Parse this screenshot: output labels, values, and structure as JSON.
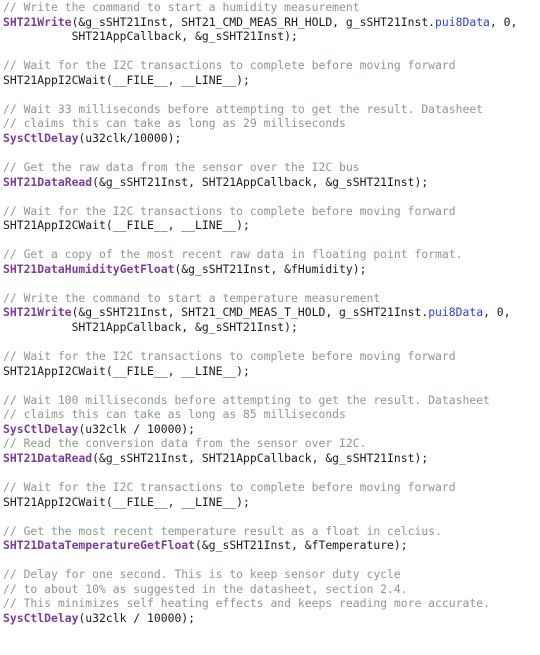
{
  "editor": {
    "language": "C",
    "background_color": "#ffffff",
    "comment_color": "#8a9a8a",
    "function_color": "#7d3c98",
    "member_color": "#2e3fd4",
    "number_color": "#1a1aa8",
    "plain_color": "#1b1b1b"
  },
  "lines": [
    {
      "n": 1,
      "type": "comment",
      "text": "// Write the command to start a humidity measurement"
    },
    {
      "n": 2,
      "type": "code",
      "func": "SHT21Write",
      "after": "(&g_sSHT21Inst, SHT21_CMD_MEAS_RH_HOLD, g_sSHT21Inst.",
      "member": "pui8Data",
      "tail": ", 0,"
    },
    {
      "n": 3,
      "type": "code",
      "text": "          SHT21AppCallback, &g_sSHT21Inst);"
    },
    {
      "n": 4,
      "type": "blank",
      "text": ""
    },
    {
      "n": 5,
      "type": "comment",
      "text": "// Wait for the I2C transactions to complete before moving forward"
    },
    {
      "n": 6,
      "type": "code",
      "text": "SHT21AppI2CWait(__FILE__, __LINE__);"
    },
    {
      "n": 7,
      "type": "blank",
      "text": ""
    },
    {
      "n": 8,
      "type": "comment",
      "text": "// Wait 33 milliseconds before attempting to get the result. Datasheet"
    },
    {
      "n": 9,
      "type": "comment",
      "text": "// claims this can take as long as 29 milliseconds"
    },
    {
      "n": 10,
      "type": "code",
      "func": "SysCtlDelay",
      "after": "(u32clk/10000);"
    },
    {
      "n": 11,
      "type": "blank",
      "text": ""
    },
    {
      "n": 12,
      "type": "comment",
      "text": "// Get the raw data from the sensor over the I2C bus"
    },
    {
      "n": 13,
      "type": "code",
      "func": "SHT21DataRead",
      "after": "(&g_sSHT21Inst, SHT21AppCallback, &g_sSHT21Inst);"
    },
    {
      "n": 14,
      "type": "blank",
      "text": ""
    },
    {
      "n": 15,
      "type": "comment",
      "text": "// Wait for the I2C transactions to complete before moving forward"
    },
    {
      "n": 16,
      "type": "code",
      "text": "SHT21AppI2CWait(__FILE__, __LINE__);"
    },
    {
      "n": 17,
      "type": "blank",
      "text": ""
    },
    {
      "n": 18,
      "type": "comment",
      "text": "// Get a copy of the most recent raw data in floating point format."
    },
    {
      "n": 19,
      "type": "code",
      "func": "SHT21DataHumidityGetFloat",
      "after": "(&g_sSHT21Inst, &fHumidity);"
    },
    {
      "n": 20,
      "type": "blank",
      "text": ""
    },
    {
      "n": 21,
      "type": "comment",
      "text": "// Write the command to start a temperature measurement"
    },
    {
      "n": 22,
      "type": "code",
      "func": "SHT21Write",
      "after": "(&g_sSHT21Inst, SHT21_CMD_MEAS_T_HOLD, g_sSHT21Inst.",
      "member": "pui8Data",
      "tail": ", 0,"
    },
    {
      "n": 23,
      "type": "code",
      "text": "          SHT21AppCallback, &g_sSHT21Inst);"
    },
    {
      "n": 24,
      "type": "blank",
      "text": ""
    },
    {
      "n": 25,
      "type": "comment",
      "text": "// Wait for the I2C transactions to complete before moving forward"
    },
    {
      "n": 26,
      "type": "code",
      "text": "SHT21AppI2CWait(__FILE__, __LINE__);"
    },
    {
      "n": 27,
      "type": "blank",
      "text": ""
    },
    {
      "n": 28,
      "type": "comment",
      "text": "// Wait 100 milliseconds before attempting to get the result. Datasheet"
    },
    {
      "n": 29,
      "type": "comment",
      "text": "// claims this can take as long as 85 milliseconds"
    },
    {
      "n": 30,
      "type": "code",
      "func": "SysCtlDelay",
      "after": "(u32clk / 10000);"
    },
    {
      "n": 31,
      "type": "comment",
      "text": "// Read the conversion data from the sensor over I2C."
    },
    {
      "n": 32,
      "type": "code",
      "func": "SHT21DataRead",
      "after": "(&g_sSHT21Inst, SHT21AppCallback, &g_sSHT21Inst);"
    },
    {
      "n": 33,
      "type": "blank",
      "text": ""
    },
    {
      "n": 34,
      "type": "comment",
      "text": "// Wait for the I2C transactions to complete before moving forward"
    },
    {
      "n": 35,
      "type": "code",
      "text": "SHT21AppI2CWait(__FILE__, __LINE__);"
    },
    {
      "n": 36,
      "type": "blank",
      "text": ""
    },
    {
      "n": 37,
      "type": "comment",
      "text": "// Get the most recent temperature result as a float in celcius."
    },
    {
      "n": 38,
      "type": "code",
      "func": "SHT21DataTemperatureGetFloat",
      "after": "(&g_sSHT21Inst, &fTemperature);"
    },
    {
      "n": 39,
      "type": "blank",
      "text": ""
    },
    {
      "n": 40,
      "type": "comment",
      "text": "// Delay for one second. This is to keep sensor duty cycle"
    },
    {
      "n": 41,
      "type": "comment",
      "text": "// to about 10% as suggested in the datasheet, section 2.4."
    },
    {
      "n": 42,
      "type": "comment",
      "text": "// This minimizes self heating effects and keeps reading more accurate."
    },
    {
      "n": 43,
      "type": "code",
      "func": "SysCtlDelay",
      "after": "(u32clk / 10000);"
    },
    {
      "n": 44,
      "type": "blank",
      "text": ""
    },
    {
      "n": 45,
      "type": "blank",
      "text": ""
    }
  ]
}
